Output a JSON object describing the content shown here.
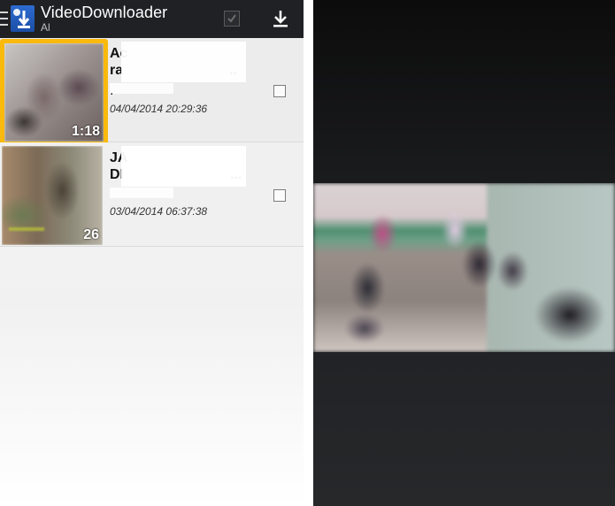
{
  "app": {
    "title": "VideoDownloader",
    "subtitle": "Al",
    "icons": {
      "drawer": "menu-icon",
      "logo": "video-downloader-logo-icon",
      "select_all": "check-all-icon",
      "download": "download-icon"
    }
  },
  "videos": [
    {
      "title": "Ac\nra                           ..",
      "subtitle": ".",
      "date": "04/04/2014 20:29:36",
      "duration": "1:18",
      "selected": true
    },
    {
      "title": "JA\nDI                           ...",
      "subtitle": "",
      "date": "03/04/2014 06:37:38",
      "duration": "26",
      "selected": false
    }
  ],
  "colors": {
    "actionbar": "#1f2124",
    "highlight": "#f9b90d",
    "player_bg": "#1a1b1d"
  }
}
